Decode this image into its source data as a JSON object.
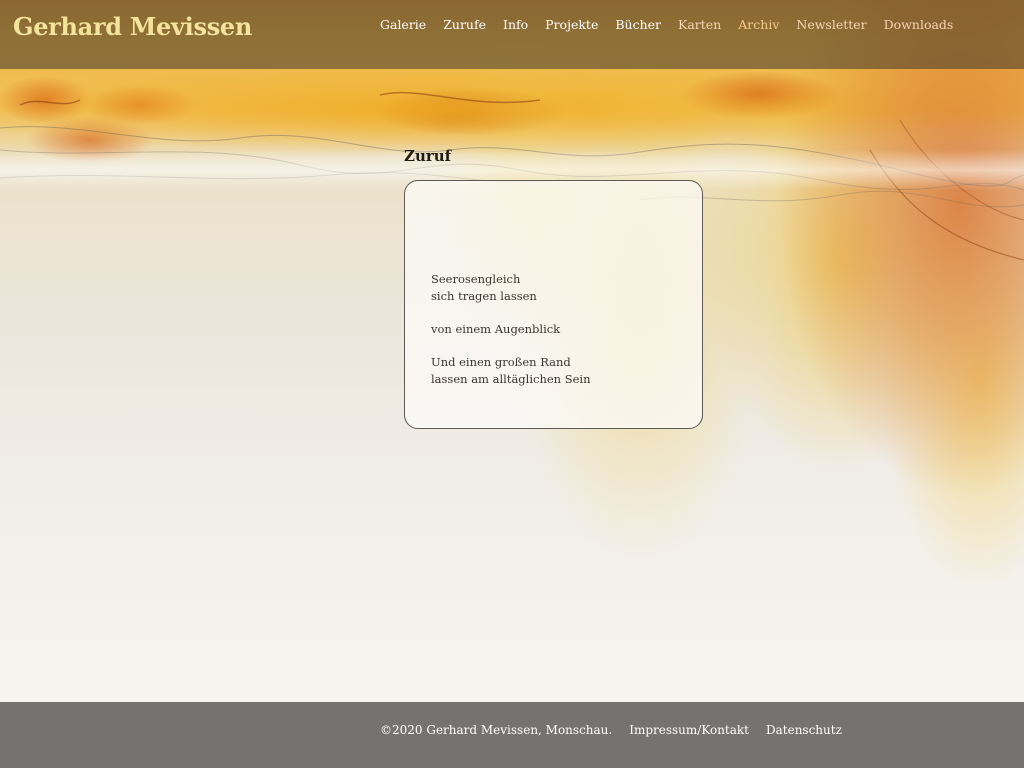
{
  "header": {
    "site_title": "Gerhard Mevissen",
    "nav": [
      {
        "label": "Galerie"
      },
      {
        "label": "Zurufe"
      },
      {
        "label": "Info"
      },
      {
        "label": "Projekte"
      },
      {
        "label": "Bücher"
      },
      {
        "label": "Karten"
      },
      {
        "label": "Archiv"
      },
      {
        "label": "Newsletter"
      },
      {
        "label": "Downloads"
      }
    ]
  },
  "main": {
    "heading": "Zuruf",
    "poem": {
      "stanzas": [
        [
          "Seerosengleich",
          "sich tragen lassen"
        ],
        [
          "von einem Augenblick"
        ],
        [
          "Und einen großen Rand",
          "lassen am alltäglichen Sein"
        ]
      ]
    }
  },
  "footer": {
    "copyright": "©2020 Gerhard Mevissen, Monschau.",
    "links": [
      {
        "label": "Impressum/Kontakt"
      },
      {
        "label": "Datenschutz"
      }
    ]
  },
  "colors": {
    "title": "#f4e39a",
    "header_bg": "#483e2c",
    "footer_bg": "#757370",
    "accent_orange": "#d6681f",
    "accent_yellow": "#f0c25a"
  }
}
